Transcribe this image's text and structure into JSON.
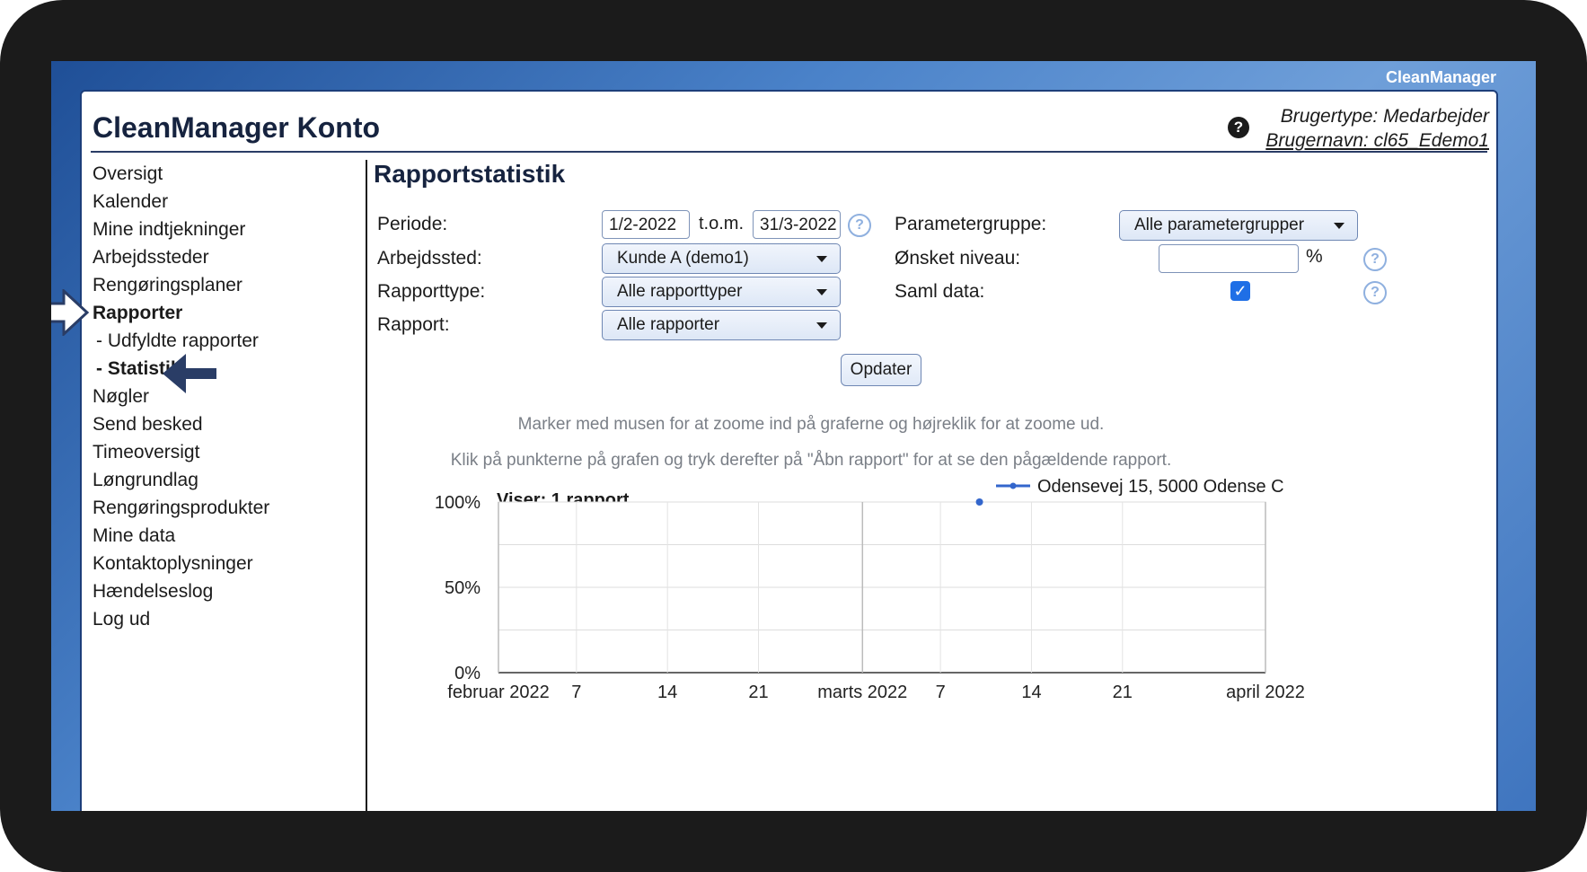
{
  "app": {
    "brand": "CleanManager",
    "title": "CleanManager Konto"
  },
  "user": {
    "type": "Brugertype: Medarbejder",
    "name": "Brugernavn: cl65_Edemo1"
  },
  "help_glyph": "?",
  "sidebar": {
    "items": [
      {
        "label": "Oversigt",
        "bold": false
      },
      {
        "label": "Kalender",
        "bold": false
      },
      {
        "label": "Mine indtjekninger",
        "bold": false
      },
      {
        "label": "Arbejdssteder",
        "bold": false
      },
      {
        "label": "Rengøringsplaner",
        "bold": false
      },
      {
        "label": "Rapporter",
        "bold": true
      },
      {
        "label": " - Udfyldte rapporter",
        "bold": false
      },
      {
        "label": " - Statistik",
        "bold": true
      },
      {
        "label": "Nøgler",
        "bold": false
      },
      {
        "label": "Send besked",
        "bold": false
      },
      {
        "label": "Timeoversigt",
        "bold": false
      },
      {
        "label": "Løngrundlag",
        "bold": false
      },
      {
        "label": "Rengøringsprodukter",
        "bold": false
      },
      {
        "label": "Mine data",
        "bold": false
      },
      {
        "label": "Kontaktoplysninger",
        "bold": false
      },
      {
        "label": "Hændelseslog",
        "bold": false
      },
      {
        "label": "Log ud",
        "bold": false
      }
    ]
  },
  "main": {
    "heading": "Rapportstatistik",
    "form": {
      "periode_label": "Periode:",
      "periode_from": "1/2-2022",
      "periode_sep": "t.o.m.",
      "periode_to": "31/3-2022",
      "arbejdssted_label": "Arbejdssted:",
      "arbejdssted_value": "Kunde A (demo1)",
      "rapporttype_label": "Rapporttype:",
      "rapporttype_value": "Alle rapporttyper",
      "rapport_label": "Rapport:",
      "rapport_value": "Alle rapporter",
      "parametergruppe_label": "Parametergruppe:",
      "parametergruppe_value": "Alle parametergrupper",
      "niveau_label": "Ønsket niveau:",
      "niveau_value": "",
      "niveau_unit": "%",
      "saml_label": "Saml data:",
      "saml_checked": true,
      "update_button": "Opdater"
    },
    "hint1": "Marker med musen for at zoome ind på graferne og højreklik for at zoome ud.",
    "hint2": "Klik på punkterne på grafen og tryk derefter på \"Åbn rapport\" for at se den pågældende rapport."
  },
  "chart_data": {
    "type": "line",
    "title": "Viser: 1 rapport",
    "series": [
      {
        "name": "Odensevej 15, 5000 Odense C",
        "color": "#3366cc",
        "points": [
          {
            "x": "2022-03-10",
            "y": 100
          }
        ]
      }
    ],
    "x_range": [
      "2022-02-01",
      "2022-04-01"
    ],
    "x_ticks": [
      {
        "date": "2022-02-01",
        "label": "februar 2022"
      },
      {
        "date": "2022-02-07",
        "label": "7"
      },
      {
        "date": "2022-02-14",
        "label": "14"
      },
      {
        "date": "2022-02-21",
        "label": "21"
      },
      {
        "date": "2022-03-01",
        "label": "marts 2022"
      },
      {
        "date": "2022-03-07",
        "label": "7"
      },
      {
        "date": "2022-03-14",
        "label": "14"
      },
      {
        "date": "2022-03-21",
        "label": "21"
      },
      {
        "date": "2022-04-01",
        "label": "april 2022"
      }
    ],
    "y_ticks": [
      {
        "value": 100,
        "label": "100%"
      },
      {
        "value": 50,
        "label": "50%"
      },
      {
        "value": 0,
        "label": "0%"
      }
    ],
    "ylim": [
      0,
      100
    ],
    "grid": true,
    "legend": "top-right"
  }
}
